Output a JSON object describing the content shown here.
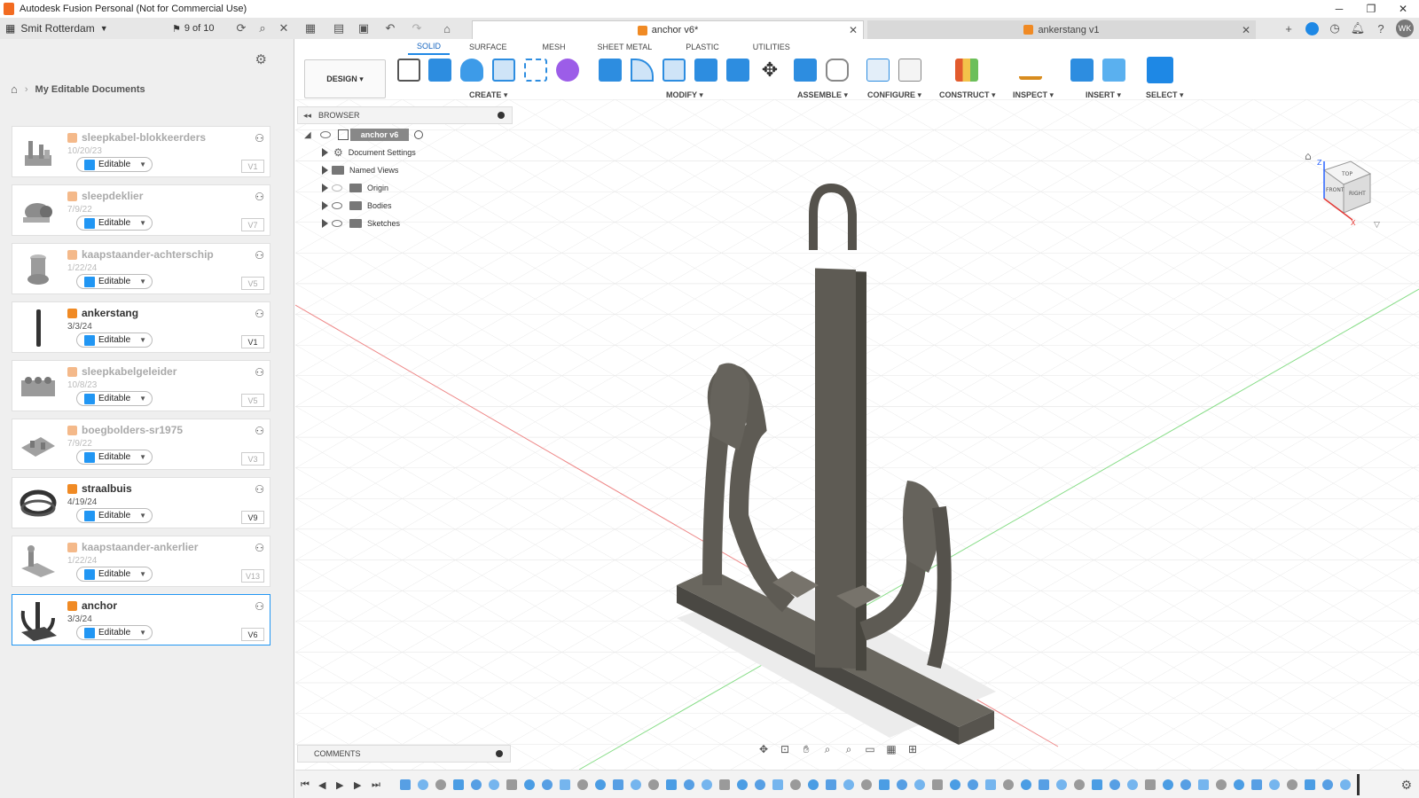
{
  "window": {
    "title": "Autodesk Fusion Personal (Not for Commercial Use)",
    "controls": [
      "─",
      "❐",
      "✕"
    ]
  },
  "appbar": {
    "team_name": "Smit Rotterdam",
    "jobs_label": "9 of 10"
  },
  "tabs": [
    {
      "label": "anchor v6*",
      "active": true
    },
    {
      "label": "ankerstang v1",
      "active": false
    }
  ],
  "user": {
    "initials": "WK"
  },
  "data_panel": {
    "breadcrumb": "My Editable Documents",
    "items": [
      {
        "name": "sleepkabel-blokkeerders",
        "date": "10/20/23",
        "status": "Editable",
        "version": "V1",
        "dim": true
      },
      {
        "name": "sleepdeklier",
        "date": "7/9/22",
        "status": "Editable",
        "version": "V7",
        "dim": true
      },
      {
        "name": "kaapstaander-achterschip",
        "date": "1/22/24",
        "status": "Editable",
        "version": "V5",
        "dim": true
      },
      {
        "name": "ankerstang",
        "date": "3/3/24",
        "status": "Editable",
        "version": "V1",
        "dim": false
      },
      {
        "name": "sleepkabelgeleider",
        "date": "10/8/23",
        "status": "Editable",
        "version": "V5",
        "dim": true
      },
      {
        "name": "boegbolders-sr1975",
        "date": "7/9/22",
        "status": "Editable",
        "version": "V3",
        "dim": true
      },
      {
        "name": "straalbuis",
        "date": "4/19/24",
        "status": "Editable",
        "version": "V9",
        "dim": false
      },
      {
        "name": "kaapstaander-ankerlier",
        "date": "1/22/24",
        "status": "Editable",
        "version": "V13",
        "dim": true
      },
      {
        "name": "anchor",
        "date": "3/3/24",
        "status": "Editable",
        "version": "V6",
        "dim": false,
        "selected": true
      }
    ]
  },
  "ribbon": {
    "workspace_button": "DESIGN ▾",
    "tabs": [
      "SOLID",
      "SURFACE",
      "MESH",
      "SHEET METAL",
      "PLASTIC",
      "UTILITIES"
    ],
    "groups": [
      "CREATE ▾",
      "MODIFY ▾",
      "ASSEMBLE ▾",
      "CONFIGURE ▾",
      "CONSTRUCT ▾",
      "INSPECT ▾",
      "INSERT ▾",
      "SELECT ▾"
    ]
  },
  "browser": {
    "title": "BROWSER",
    "root": "anchor v6",
    "nodes": [
      "Document Settings",
      "Named Views",
      "Origin",
      "Bodies",
      "Sketches"
    ]
  },
  "comments": {
    "title": "COMMENTS"
  },
  "viewcube": {
    "top": "TOP",
    "front": "FRONT",
    "right": "RIGHT",
    "axis_x": "X",
    "axis_z": "Z"
  },
  "colors": {
    "accent": "#1e88e5",
    "brand_orange": "#f26b21",
    "model": "#5e5b54",
    "grid_line": "#e6e6e6"
  }
}
